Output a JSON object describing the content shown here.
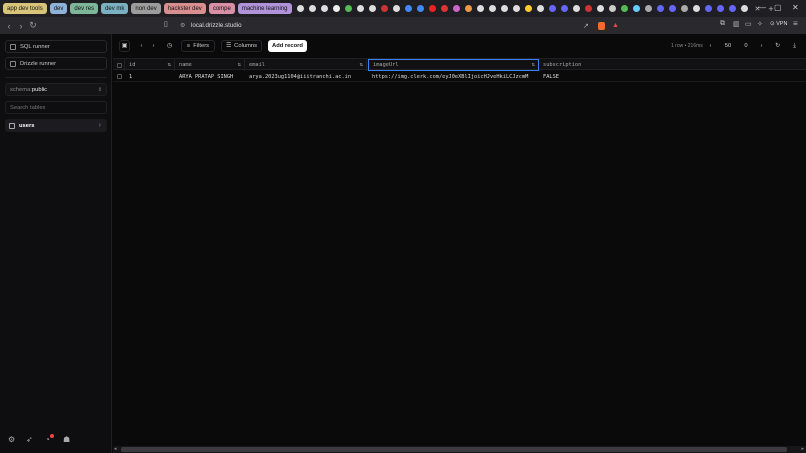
{
  "colors": {
    "accent": "#3b82f6",
    "tab_bg": "#1f1f23",
    "sidebar_bg": "#0e0e10"
  },
  "browser": {
    "tab_groups": [
      {
        "label": "app dev tools",
        "color": "#d9c57a"
      },
      {
        "label": "dev",
        "color": "#8fb2d9"
      },
      {
        "label": "dev res",
        "color": "#7db69a"
      },
      {
        "label": "dev mk",
        "color": "#7ab1c2"
      },
      {
        "label": "non dev",
        "color": "#9c9c9c"
      },
      {
        "label": "hackster dev",
        "color": "#d98f8f"
      },
      {
        "label": "compe",
        "color": "#d98fa6"
      },
      {
        "label": "machine learning",
        "color": "#b093d9"
      }
    ],
    "url": "local.drizzle.studio",
    "vpn_label": "VPN"
  },
  "sidebar": {
    "sql_runner": "SQL runner",
    "drizzle_runner": "Drizzle runner",
    "schema_label": "schema:",
    "schema_value": "public",
    "search_placeholder": "Search tables",
    "tables": [
      {
        "label": "users"
      }
    ]
  },
  "toolbar": {
    "filters_label": "Filters",
    "columns_label": "Columns",
    "add_record_label": "Add record",
    "row_info": "1 row • 216ms",
    "page_size": "50",
    "offset": "0"
  },
  "table": {
    "columns": [
      "id",
      "name",
      "email",
      "imageUrl",
      "subscription"
    ],
    "rows": [
      [
        "1",
        "ARYA PRATAP SINGH",
        "arya.2023ug1104@iiitranchi.ac.in",
        "https://img.clerk.com/eyJ0eXBlIjoicHJveHkiLCJzcmM",
        "FALSE"
      ]
    ]
  }
}
